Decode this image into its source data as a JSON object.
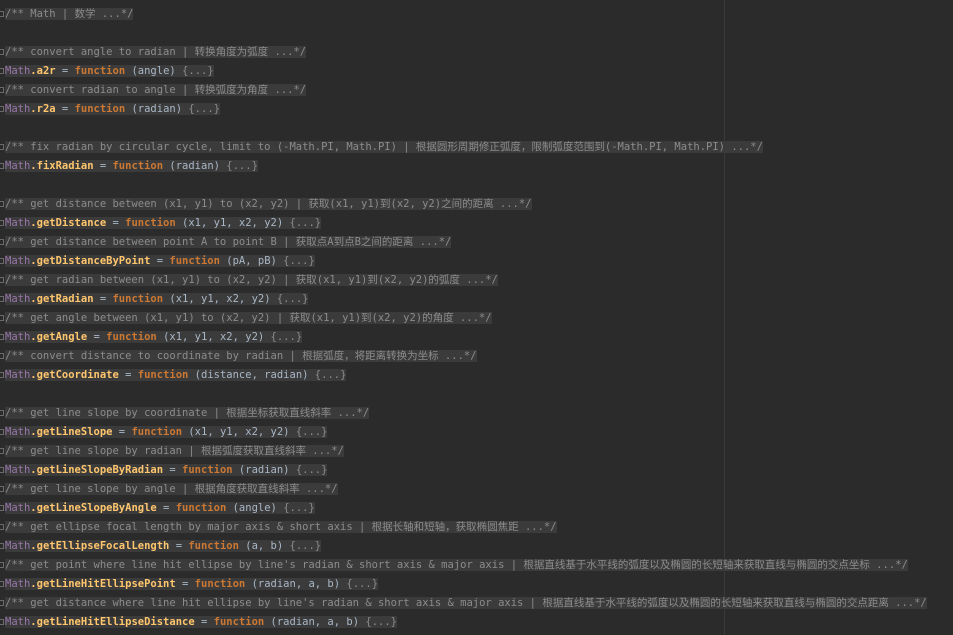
{
  "lines": [
    {
      "kind": "comment",
      "text": "/** Math | 数学 ...*/"
    },
    {
      "kind": "blank"
    },
    {
      "kind": "comment",
      "text": "/** convert angle to radian | 转换角度为弧度 ...*/"
    },
    {
      "kind": "code",
      "obj": "Math",
      "name": ".a2r",
      "op": " = ",
      "kw": "function",
      "params": " (angle) ",
      "body": "{...}"
    },
    {
      "kind": "comment",
      "text": "/** convert radian to angle | 转换弧度为角度 ...*/"
    },
    {
      "kind": "code",
      "obj": "Math",
      "name": ".r2a",
      "op": " = ",
      "kw": "function",
      "params": " (radian) ",
      "body": "{...}"
    },
    {
      "kind": "blank"
    },
    {
      "kind": "comment",
      "text": "/** fix radian by circular cycle, limit to (-Math.PI, Math.PI) | 根据圆形周期修正弧度，限制弧度范围到(-Math.PI, Math.PI) ...*/"
    },
    {
      "kind": "code",
      "obj": "Math",
      "name": ".fixRadian",
      "op": " = ",
      "kw": "function",
      "params": " (radian) ",
      "body": "{...}"
    },
    {
      "kind": "blank"
    },
    {
      "kind": "comment",
      "text": "/** get distance between (x1, y1) to (x2, y2) | 获取(x1, y1)到(x2, y2)之间的距离 ...*/"
    },
    {
      "kind": "code",
      "obj": "Math",
      "name": ".getDistance",
      "op": " = ",
      "kw": "function",
      "params": " (x1, y1, x2, y2) ",
      "body": "{...}"
    },
    {
      "kind": "comment",
      "text": "/** get distance between point A to point B | 获取点A到点B之间的距离 ...*/"
    },
    {
      "kind": "code",
      "obj": "Math",
      "name": ".getDistanceByPoint",
      "op": " = ",
      "kw": "function",
      "params": " (pA, pB) ",
      "body": "{...}"
    },
    {
      "kind": "comment",
      "text": "/** get radian between (x1, y1) to (x2, y2) | 获取(x1, y1)到(x2, y2)的弧度 ...*/"
    },
    {
      "kind": "code",
      "obj": "Math",
      "name": ".getRadian",
      "op": " = ",
      "kw": "function",
      "params": " (x1, y1, x2, y2) ",
      "body": "{...}"
    },
    {
      "kind": "comment",
      "text": "/** get angle between (x1, y1) to (x2, y2) | 获取(x1, y1)到(x2, y2)的角度 ...*/"
    },
    {
      "kind": "code",
      "obj": "Math",
      "name": ".getAngle",
      "op": " = ",
      "kw": "function",
      "params": " (x1, y1, x2, y2) ",
      "body": "{...}"
    },
    {
      "kind": "comment",
      "text": "/** convert distance to coordinate by radian | 根据弧度，将距离转换为坐标 ...*/"
    },
    {
      "kind": "code",
      "obj": "Math",
      "name": ".getCoordinate",
      "op": " = ",
      "kw": "function",
      "params": " (distance, radian) ",
      "body": "{...}"
    },
    {
      "kind": "blank"
    },
    {
      "kind": "comment",
      "text": "/** get line slope by coordinate | 根据坐标获取直线斜率 ...*/"
    },
    {
      "kind": "code",
      "obj": "Math",
      "name": ".getLineSlope",
      "op": " = ",
      "kw": "function",
      "params": " (x1, y1, x2, y2) ",
      "body": "{...}"
    },
    {
      "kind": "comment",
      "text": "/** get line slope by radian | 根据弧度获取直线斜率 ...*/"
    },
    {
      "kind": "code",
      "obj": "Math",
      "name": ".getLineSlopeByRadian",
      "op": " = ",
      "kw": "function",
      "params": " (radian) ",
      "body": "{...}"
    },
    {
      "kind": "comment",
      "text": "/** get line slope by angle | 根据角度获取直线斜率 ...*/"
    },
    {
      "kind": "code",
      "obj": "Math",
      "name": ".getLineSlopeByAngle",
      "op": " = ",
      "kw": "function",
      "params": " (angle) ",
      "body": "{...}"
    },
    {
      "kind": "comment",
      "text": "/** get ellipse focal length by major axis & short axis | 根据长轴和短轴，获取椭圆焦距 ...*/"
    },
    {
      "kind": "code",
      "obj": "Math",
      "name": ".getEllipseFocalLength",
      "op": " = ",
      "kw": "function",
      "params": " (a, b) ",
      "body": "{...}"
    },
    {
      "kind": "comment",
      "text": "/** get point where line hit ellipse by line's radian & short axis & major axis | 根据直线基于水平线的弧度以及椭圆的长短轴来获取直线与椭圆的交点坐标 ...*/"
    },
    {
      "kind": "code",
      "obj": "Math",
      "name": ".getLineHitEllipsePoint",
      "op": " = ",
      "kw": "function",
      "params": " (radian, a, b) ",
      "body": "{...}"
    },
    {
      "kind": "comment",
      "text": "/** get distance where line hit ellipse by line's radian & short axis & major axis | 根据直线基于水平线的弧度以及椭圆的长短轴来获取直线与椭圆的交点距离 ...*/"
    },
    {
      "kind": "code",
      "obj": "Math",
      "name": ".getLineHitEllipseDistance",
      "op": " = ",
      "kw": "function",
      "params": " (radian, a, b) ",
      "body": "{...}"
    }
  ]
}
